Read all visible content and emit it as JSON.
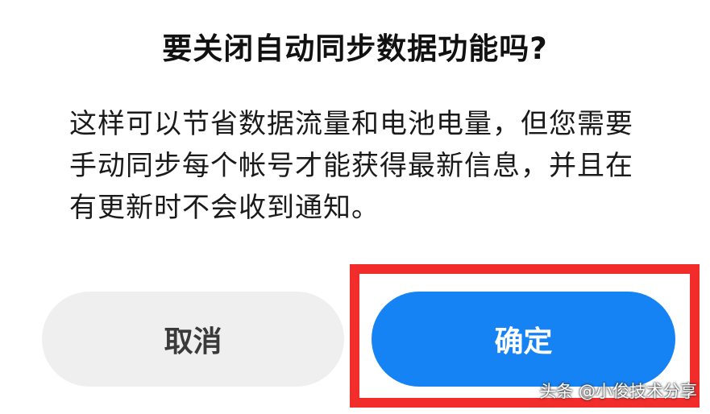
{
  "dialog": {
    "title": "要关闭自动同步数据功能吗?",
    "message": "这样可以节省数据流量和电池电量，但您需要手动同步每个帐号才能获得最新信息，并且在有更新时不会收到通知。",
    "cancel_label": "取消",
    "confirm_label": "确定"
  },
  "watermark": "头条 @小俊技术分享",
  "colors": {
    "confirm_bg": "#1683f5",
    "cancel_bg": "#efefef",
    "highlight": "#f22b2b"
  }
}
